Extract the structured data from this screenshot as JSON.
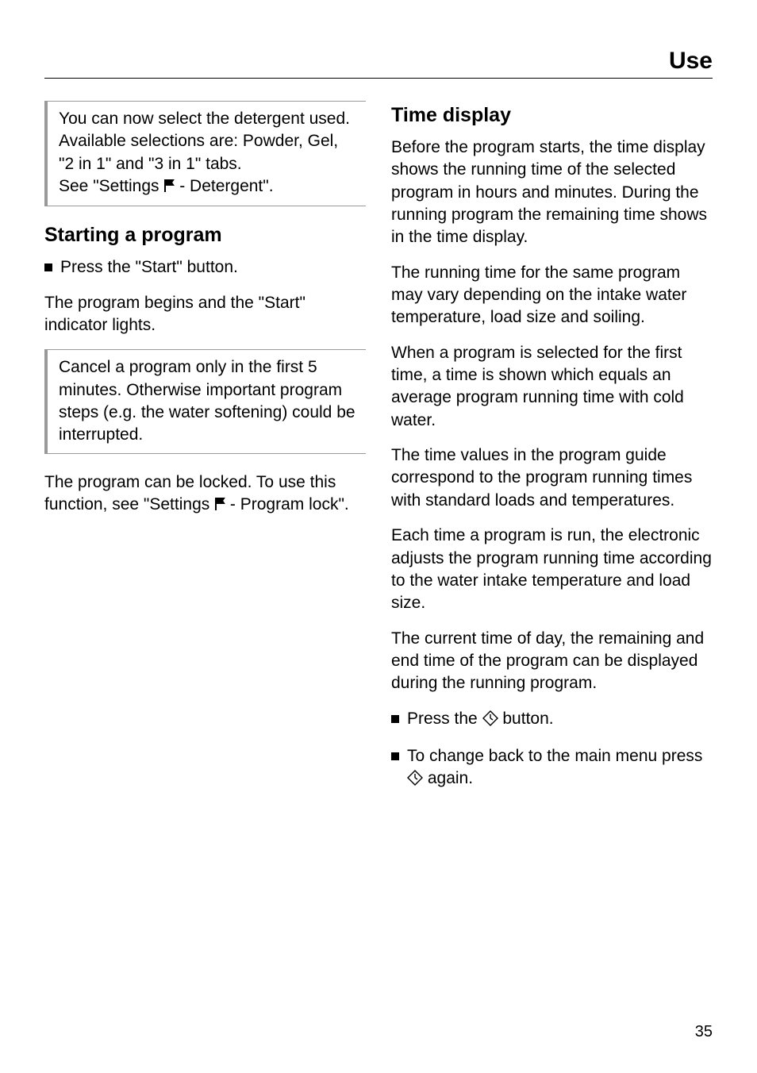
{
  "header": {
    "title": "Use"
  },
  "left": {
    "box1": {
      "line1": "You can now select the detergent used. Available selections are: Powder, Gel, \"2 in 1\" and \"3 in 1\" tabs.",
      "line2a": "See \"Settings ",
      "line2b": " - Detergent\"."
    },
    "h_start": "Starting a program",
    "bullet1": "Press the \"Start\" button.",
    "p1": "The program begins and the \"Start\" indicator lights.",
    "box2": {
      "text": "Cancel a program only in the first 5 minutes. Otherwise important program steps (e.g. the water softening) could be interrupted."
    },
    "p2a": "The program can be locked. To use this function, see \"Settings ",
    "p2b": " - Program lock\"."
  },
  "right": {
    "h_time": "Time display",
    "p1": "Before the program starts, the time display shows the running time of the selected program in hours and minutes. During the running program the remaining time shows in the time display.",
    "p2": "The running time for the same program may vary depending on the intake water temperature, load size and soiling.",
    "p3": "When a program is selected for the first time, a time is shown which equals an average program running time with cold water.",
    "p4": "The time values in the program guide correspond to the program running times with standard loads and temperatures.",
    "p5": "Each time a program is run, the electronic adjusts the program running time according to the water intake temperature and load size.",
    "p6": "The current time of day, the remaining and end time of the program can be displayed during the running program.",
    "bullet1a": "Press the ",
    "bullet1b": " button.",
    "bullet2a": "To change back to the main menu press ",
    "bullet2b": " again."
  },
  "page_number": "35"
}
